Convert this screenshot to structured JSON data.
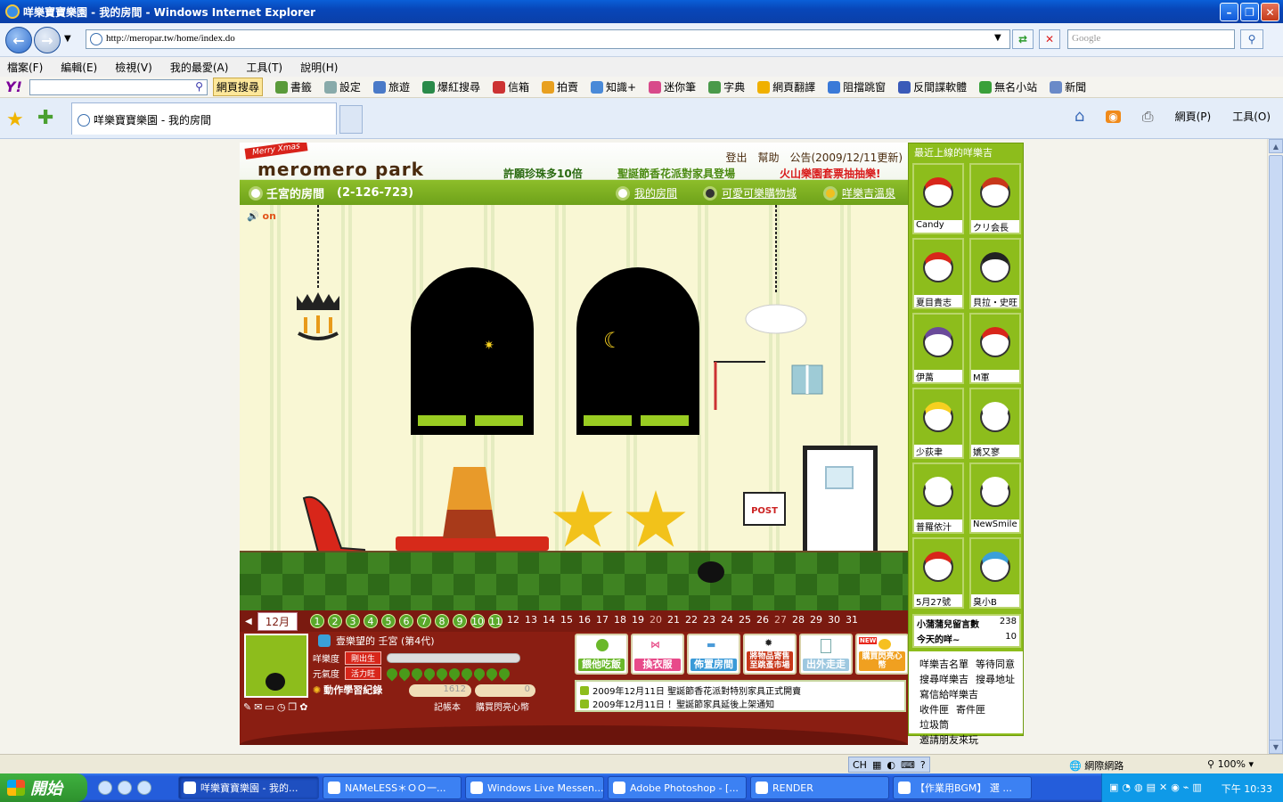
{
  "window": {
    "title": "咩樂寶寶樂園 - 我的房間 - Windows Internet Explorer"
  },
  "address": {
    "url": "http://meropar.tw/home/index.do",
    "search_placeholder": "Google"
  },
  "menu": [
    "檔案(F)",
    "編輯(E)",
    "檢視(V)",
    "我的最愛(A)",
    "工具(T)",
    "說明(H)"
  ],
  "yahoo_toolbar": {
    "logo": "Y!",
    "search_button": "網頁搜尋",
    "items": [
      "書籤",
      "設定",
      "旅遊",
      "爆紅搜尋",
      "信箱",
      "拍賣",
      "知識+",
      "迷你筆",
      "字典",
      "網頁翻譯",
      "阻擋跳窗",
      "反間諜軟體",
      "無名小站",
      "新聞"
    ]
  },
  "tabs": {
    "active_tab": "咩樂寶寶樂園 - 我的房間"
  },
  "command_bar": {
    "page": "網頁(P)",
    "tools": "工具(O)"
  },
  "game": {
    "banner": {
      "xmas": "Merry Xmas",
      "logo": "meromero park",
      "promo1": "許願珍珠多10倍",
      "promo2": "聖誕節香花派對家具登場",
      "promo3": "火山樂園套票抽抽樂!",
      "logout": "登出",
      "help": "幫助",
      "notice": "公告(2009/12/11更新)"
    },
    "room_bar": {
      "title": "壬宮的房間",
      "room_id": "(2-126-723)",
      "my_room": "我的房間",
      "shop": "可愛可樂購物城",
      "onsen": "咩樂吉溫泉"
    },
    "room": {
      "sound": "on",
      "post_label": "POST"
    },
    "calendar": {
      "month": "12月",
      "days": [
        "1",
        "2",
        "3",
        "4",
        "5",
        "6",
        "7",
        "8",
        "9",
        "10",
        "11",
        "12",
        "13",
        "14",
        "15",
        "16",
        "17",
        "18",
        "19",
        "20",
        "21",
        "22",
        "23",
        "24",
        "25",
        "26",
        "27",
        "28",
        "29",
        "30",
        "31"
      ],
      "done_days": 11
    },
    "status": {
      "name": "壹樂望的 壬宮 (第4代)",
      "meromero_label": "咩樂度",
      "meromero_tag": "剛出生",
      "energy_label": "元氣度",
      "energy_tag": "活力旺",
      "learn": "動作學習紀錄",
      "diary_count": "1612",
      "diary_label": "記帳本",
      "coins_count": "0",
      "coins_label": "購買閃亮心幣"
    },
    "actions": [
      "餵他吃飯",
      "換衣服",
      "佈置房間",
      "將物品寄售至跳蚤市場",
      "出外走走",
      "購買閃亮心幣"
    ],
    "action_new": "NEW",
    "news": [
      "2009年12月11日 聖誕節香花派對特別家具正式開賣",
      "2009年12月11日 ！聖誕節家具延後上架通知"
    ]
  },
  "sidebar": {
    "header": "最近上線的咩樂吉",
    "friends": [
      "Candy",
      "クリ会長",
      "夏目貴志",
      "貝拉・史旺",
      "伊萬",
      "M軍",
      "少荻聿",
      "嬌又寥",
      "普羅依汁",
      "NewSmile",
      "5月27號",
      "臭小B"
    ],
    "msg_label": "小蒲蒲兒留言數",
    "msg_count": "238",
    "today_label": "今天的咩~",
    "today_count": "10",
    "links": [
      "咩樂吉名單",
      "等待同意",
      "搜尋咩樂吉",
      "搜尋地址",
      "寫信給咩樂吉",
      "收件匣",
      "寄件匣",
      "垃圾筒",
      "邀請朋友來玩"
    ]
  },
  "statusbar": {
    "zone": "網際網路",
    "zoom": "100%",
    "ime": "CH"
  },
  "taskbar": {
    "start": "開始",
    "tasks": [
      "咩樂寶寶樂園 - 我的...",
      "NAMeLESS＊ＯＯ一...",
      "Windows Live Messen...",
      "Adobe Photoshop - [...",
      "RENDER",
      "【作業用BGM】 選 ..."
    ],
    "clock": "下午 10:33"
  }
}
